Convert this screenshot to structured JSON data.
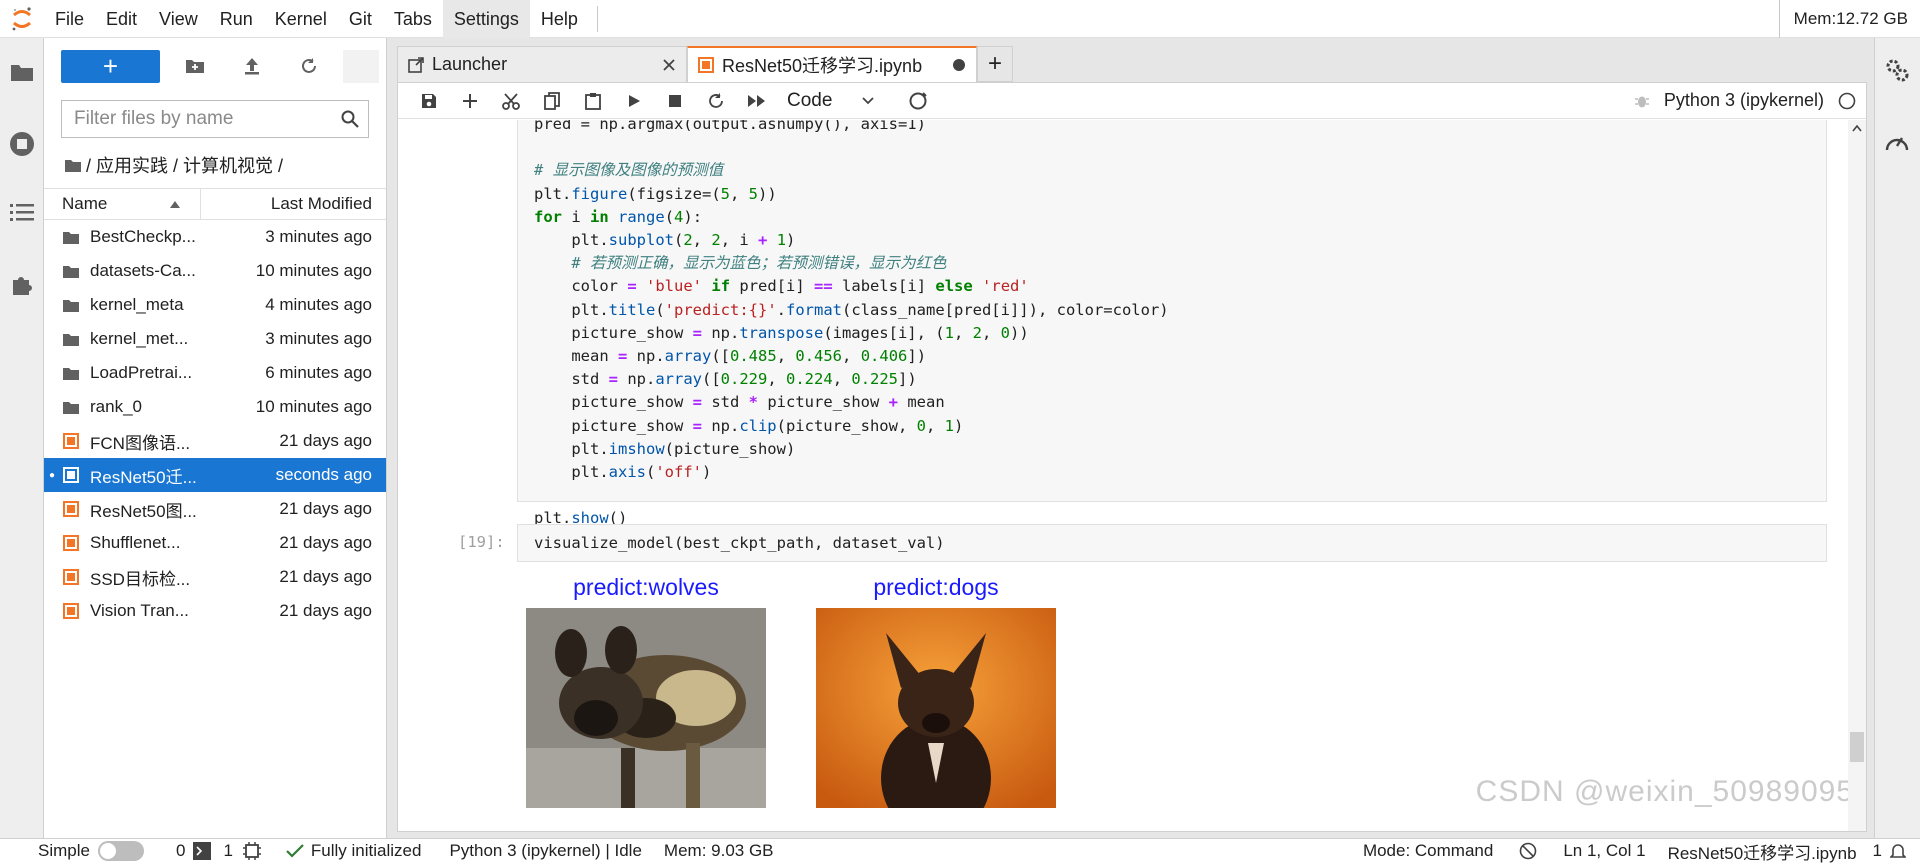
{
  "menubar": {
    "items": [
      "File",
      "Edit",
      "View",
      "Run",
      "Kernel",
      "Git",
      "Tabs",
      "Settings",
      "Help"
    ],
    "memory": "Mem:12.72 GB"
  },
  "filebrowser": {
    "filter_placeholder": "Filter files by name",
    "breadcrumb": "/ 应用实践 / 计算机视觉 /",
    "col_name": "Name",
    "col_modified": "Last Modified",
    "files": [
      {
        "name": "BestCheckp...",
        "modified": "3 minutes ago",
        "kind": "folder"
      },
      {
        "name": "datasets-Ca...",
        "modified": "10 minutes ago",
        "kind": "folder"
      },
      {
        "name": "kernel_meta",
        "modified": "4 minutes ago",
        "kind": "folder"
      },
      {
        "name": "kernel_met...",
        "modified": "3 minutes ago",
        "kind": "folder"
      },
      {
        "name": "LoadPretrai...",
        "modified": "6 minutes ago",
        "kind": "folder"
      },
      {
        "name": "rank_0",
        "modified": "10 minutes ago",
        "kind": "folder"
      },
      {
        "name": "FCN图像语...",
        "modified": "21 days ago",
        "kind": "notebook"
      },
      {
        "name": "ResNet50迁...",
        "modified": "seconds ago",
        "kind": "notebook",
        "selected": true
      },
      {
        "name": "ResNet50图...",
        "modified": "21 days ago",
        "kind": "notebook"
      },
      {
        "name": "Shufflenet...",
        "modified": "21 days ago",
        "kind": "notebook"
      },
      {
        "name": "SSD目标检...",
        "modified": "21 days ago",
        "kind": "notebook"
      },
      {
        "name": "Vision Tran...",
        "modified": "21 days ago",
        "kind": "notebook"
      }
    ]
  },
  "tabs": {
    "launcher": "Launcher",
    "notebook": "ResNet50迁移学习.ipynb",
    "add": "+"
  },
  "nb_toolbar": {
    "cell_type": "Code",
    "kernel": "Python 3 (ipykernel)"
  },
  "cells": {
    "prompt_19": "[19]:",
    "cell19_code": "visualize_model(best_ckpt_path, dataset_val)"
  },
  "outputs": [
    {
      "title": "predict:wolves"
    },
    {
      "title": "predict:dogs"
    }
  ],
  "watermark": "CSDN @weixin_50989095",
  "statusbar": {
    "mode_label": "Simple",
    "count_a": "0",
    "count_b": "1",
    "init_status": "Fully initialized",
    "kernel_status": "Python 3 (ipykernel) | Idle",
    "memory": "Mem: 9.03 GB",
    "mode": "Mode: Command",
    "position": "Ln 1, Col 1",
    "filename": "ResNet50迁移学习.ipynb",
    "tail_count": "1"
  },
  "colors": {
    "accent": "#1976d2",
    "jupyter_orange": "#f37626",
    "output_title": "#1a1aff"
  }
}
